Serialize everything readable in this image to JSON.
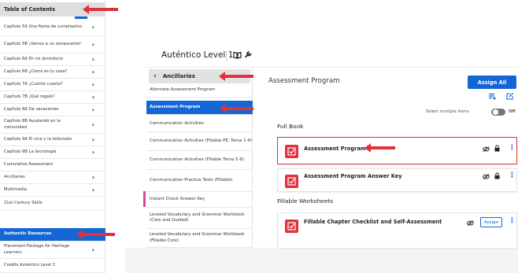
{
  "toc": {
    "header": "Table of Contents",
    "items": [
      {
        "label": "Capítulo 5A Una fiesta de cumpleaños",
        "chevron": true
      },
      {
        "label": "Capítulo 5B ¡Vamos a un restaurante!",
        "chevron": true
      },
      {
        "label": "Capítulo 6A En mi dormitorio",
        "chevron": true
      },
      {
        "label": "Capítulo 6B ¿Cómo es tu casa?",
        "chevron": true
      },
      {
        "label": "Capítulo 7A ¿Cuánto cuesta?",
        "chevron": true
      },
      {
        "label": "Capítulo 7B ¡Qué regalo!",
        "chevron": true
      },
      {
        "label": "Capítulo 8A De vacaciones",
        "chevron": true
      },
      {
        "label": "Capítulo 8B Ayudando en la comunidad",
        "chevron": true
      },
      {
        "label": "Capítulo 9A El cine y la televisión",
        "chevron": true
      },
      {
        "label": "Capítulo 9B La tecnología",
        "chevron": true
      },
      {
        "label": "Cumulative Assessment",
        "chevron": false
      },
      {
        "label": "Ancillaries",
        "chevron": true
      },
      {
        "label": "Multimedia",
        "chevron": true
      },
      {
        "label": "21st Century Skills",
        "chevron": false
      },
      {
        "label": "Authentic Resources",
        "chevron": false,
        "active": true
      },
      {
        "label": "Placement Package for Heritage Learners",
        "chevron": true
      },
      {
        "label": "Credits Auténtico Level 1",
        "chevron": false
      }
    ]
  },
  "topbar": {
    "app_title": "Auténtico Level 1",
    "book_icon": "book-open-icon",
    "wrench_icon": "wrench-icon"
  },
  "ancillaries": {
    "header": "Ancillaries",
    "items": [
      {
        "label": "Alternate Assessment Program"
      },
      {
        "label": "Assessment Program",
        "active": true
      },
      {
        "label": "Communication Activities"
      },
      {
        "label": "Communication Activities (Fillable PE, Tema 1-4)"
      },
      {
        "label": "Communication Activities (Fillable Tema 5-9)"
      },
      {
        "label": "Communication Practice Tests (Fillable)"
      },
      {
        "label": "Instant Check Answer Key"
      },
      {
        "label": "Leveled Vocabulary and Grammar Workbook (Core and Guided)"
      },
      {
        "label": "Leveled Vocabulary and Grammar Workbook (Fillable Core)"
      }
    ]
  },
  "main": {
    "title": "Assessment Program",
    "assign_all": "Assign All",
    "select_multiple": "Select multiple items",
    "toggle_label": "Off",
    "sections": [
      {
        "title": "Full Book",
        "cards": [
          {
            "title": "Assessment Program",
            "highlight": true,
            "assign_button": false
          },
          {
            "title": "Assessment Program Answer Key",
            "highlight": false,
            "assign_button": false
          }
        ]
      },
      {
        "title": "Fillable Worksheets",
        "cards": [
          {
            "title": "Fillable Chapter Checklist and Self-Assessment",
            "highlight": false,
            "assign_button": true,
            "assign_label": "Assign"
          }
        ]
      }
    ]
  },
  "colors": {
    "accent": "#1366d6",
    "arrow_red": "#e2313a",
    "icon_red": "#e2313a"
  }
}
